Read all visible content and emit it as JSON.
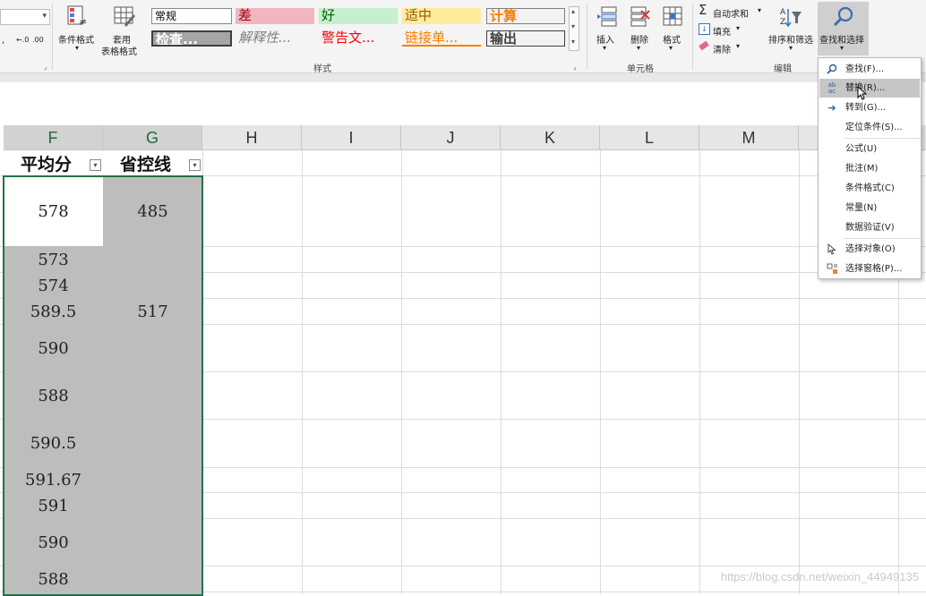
{
  "ribbon": {
    "font_group": {
      "group_label": "",
      "number_fmt_buttons": [
        ",",
        "←.0",
        ".00"
      ]
    },
    "buttons": {
      "conditional_format": "条件格式",
      "table_format_line1": "套用",
      "table_format_line2": "表格格式",
      "insert": "插入",
      "delete": "删除",
      "format": "格式",
      "autosum": "自动求和",
      "fill": "填充",
      "clear": "清除",
      "sort_filter": "排序和筛选",
      "find_select": "查找和选择"
    },
    "styles_gallery": [
      {
        "label": "常规",
        "bg": "#ffffff",
        "fg": "#000000",
        "border": "#8a8a8a"
      },
      {
        "label": "差",
        "bg": "#f0b7c0",
        "fg": "#9c0006",
        "border": "#f0b7c0"
      },
      {
        "label": "好",
        "bg": "#c6efce",
        "fg": "#006100",
        "border": "#c6efce"
      },
      {
        "label": "适中",
        "bg": "#ffeb9c",
        "fg": "#9c5700",
        "border": "#ffeb9c"
      },
      {
        "label": "计算",
        "bg": "#f2f2f2",
        "fg": "#fa7d00",
        "border": "#7f7f7f"
      },
      {
        "label": "检查...",
        "bg": "#a5a5a5",
        "fg": "#ffffff",
        "border": "#3f3f3f"
      },
      {
        "label": "解释性...",
        "bg": "#f4f4f4",
        "fg": "#7f7f7f",
        "border": "#f4f4f4"
      },
      {
        "label": "警告文...",
        "bg": "#f4f4f4",
        "fg": "#ff0000",
        "border": "#f4f4f4"
      },
      {
        "label": "链接单...",
        "bg": "#f4f4f4",
        "fg": "#fa7d00",
        "border": "#f4f4f4"
      },
      {
        "label": "输出",
        "bg": "#f2f2f2",
        "fg": "#3f3f3f",
        "border": "#3f3f3f"
      }
    ],
    "group_labels": {
      "styles": "样式",
      "cells": "单元格",
      "editing": "编辑"
    }
  },
  "columns": [
    "F",
    "G",
    "H",
    "I",
    "J",
    "K",
    "L",
    "M"
  ],
  "headers": {
    "F": "平均分",
    "G": "省控线"
  },
  "rows": [
    {
      "f": "578",
      "g": "485"
    },
    {
      "f": "573",
      "g": ""
    },
    {
      "f": "574",
      "g": ""
    },
    {
      "f": "589.5",
      "g": "517"
    },
    {
      "f": "590",
      "g": ""
    },
    {
      "f": "588",
      "g": ""
    },
    {
      "f": "590.5",
      "g": ""
    },
    {
      "f": "591.67",
      "g": ""
    },
    {
      "f": "591",
      "g": ""
    },
    {
      "f": "590",
      "g": ""
    },
    {
      "f": "588",
      "g": ""
    }
  ],
  "menu": {
    "items": [
      {
        "label": "查找(F)...",
        "icon": "search-icon"
      },
      {
        "label": "替换(R)...",
        "icon": "replace-icon",
        "highlighted": true
      },
      {
        "label": "转到(G)...",
        "icon": "arrow-right-icon"
      },
      {
        "label": "定位条件(S)...",
        "icon": ""
      },
      {
        "label": "公式(U)",
        "icon": ""
      },
      {
        "label": "批注(M)",
        "icon": ""
      },
      {
        "label": "条件格式(C)",
        "icon": ""
      },
      {
        "label": "常量(N)",
        "icon": ""
      },
      {
        "label": "数据验证(V)",
        "icon": ""
      },
      {
        "label": "选择对象(O)",
        "icon": "pointer-icon"
      },
      {
        "label": "选择窗格(P)...",
        "icon": "selection-pane-icon"
      }
    ]
  },
  "watermark": "https://blog.csdn.net/weixin_44949135",
  "colors": {
    "selection_border": "#217346",
    "selected_fill": "#bdbdbd",
    "highlight_menu": "#c6c6c6"
  }
}
